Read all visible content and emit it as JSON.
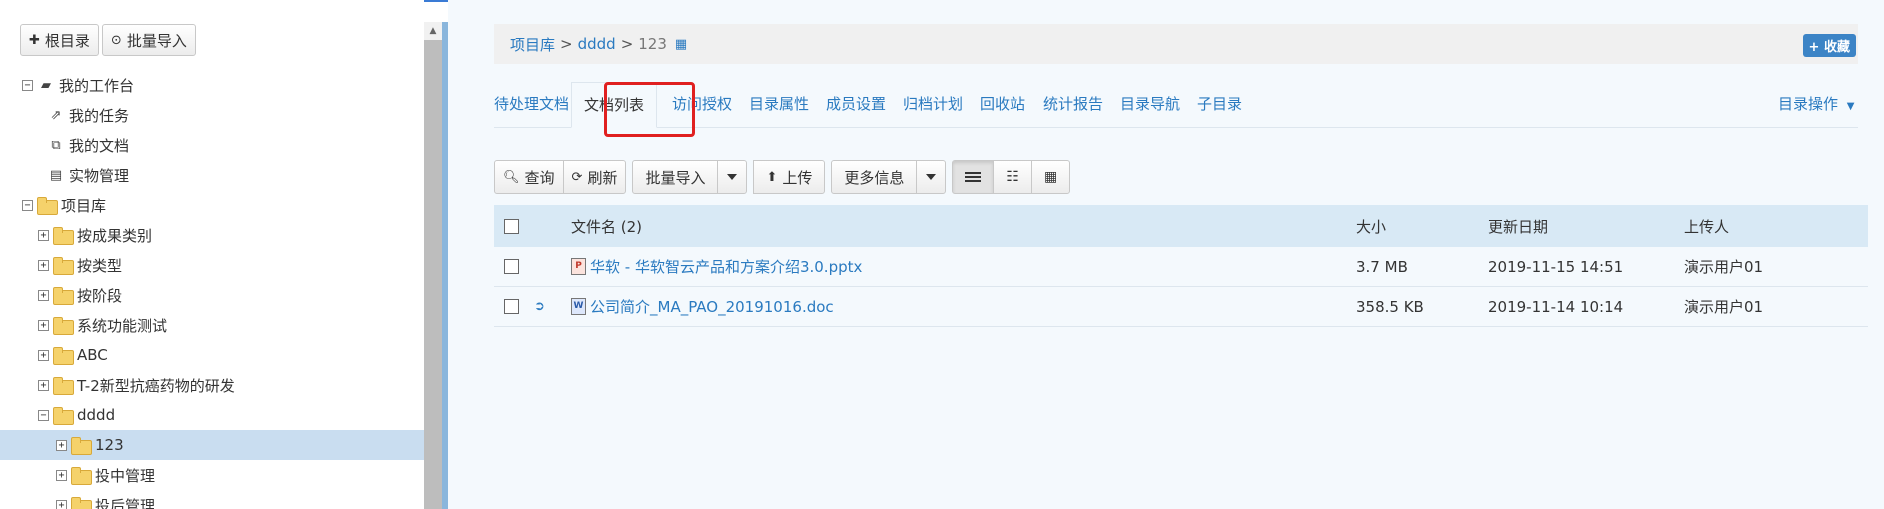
{
  "left_panel": {
    "buttons": {
      "root": "根目录",
      "batch_import": "批量导入"
    },
    "tree": [
      {
        "label": "我的工作台",
        "level": 0,
        "kind": "briefcase",
        "expand": "−"
      },
      {
        "label": "我的任务",
        "level": 1,
        "kind": "external-link"
      },
      {
        "label": "我的文档",
        "level": 1,
        "kind": "copy"
      },
      {
        "label": "实物管理",
        "level": 1,
        "kind": "server"
      },
      {
        "label": "项目库",
        "level": 0,
        "kind": "folder",
        "expand": "−"
      },
      {
        "label": "按成果类别",
        "level": 1,
        "kind": "folder",
        "expand": "+"
      },
      {
        "label": "按类型",
        "level": 1,
        "kind": "folder",
        "expand": "+"
      },
      {
        "label": "按阶段",
        "level": 1,
        "kind": "folder",
        "expand": "+"
      },
      {
        "label": "系统功能测试",
        "level": 1,
        "kind": "folder",
        "expand": "+"
      },
      {
        "label": "ABC",
        "level": 1,
        "kind": "folder",
        "expand": "+"
      },
      {
        "label": "T-2新型抗癌药物的研发",
        "level": 1,
        "kind": "folder",
        "expand": "+"
      },
      {
        "label": "dddd",
        "level": 1,
        "kind": "folder",
        "expand": "−"
      },
      {
        "label": "123",
        "level": 2,
        "kind": "folder",
        "expand": "+",
        "selected": true
      },
      {
        "label": "投中管理",
        "level": 2,
        "kind": "folder",
        "expand": "+"
      },
      {
        "label": "投后管理",
        "level": 2,
        "kind": "folder",
        "expand": "+"
      }
    ]
  },
  "breadcrumb": {
    "root": "项目库",
    "sep": ">",
    "parent": "dddd",
    "current": "123"
  },
  "favorite_label": "收藏",
  "tabs": [
    "待处理文档",
    "文档列表",
    "访问授权",
    "目录属性",
    "成员设置",
    "归档计划",
    "回收站",
    "统计报告",
    "目录导航",
    "子目录"
  ],
  "active_tab": "文档列表",
  "dir_ops_label": "目录操作",
  "toolbar": {
    "query": "查询",
    "refresh": "刷新",
    "batch_import": "批量导入",
    "upload": "上传",
    "more_info": "更多信息"
  },
  "table": {
    "headers": {
      "name": "文件名 (2)",
      "size": "大小",
      "date": "更新日期",
      "uploader": "上传人"
    },
    "rows": [
      {
        "name": "华软 - 华软智云产品和方案介绍3.0.pptx",
        "type": "ppt",
        "size": "3.7 MB",
        "date": "2019-11-15 14:51",
        "uploader": "演示用户01",
        "checked_out": false
      },
      {
        "name": "公司简介_MA_PAO_20191016.doc",
        "type": "doc",
        "size": "358.5 KB",
        "date": "2019-11-14 10:14",
        "uploader": "演示用户01",
        "checked_out": true
      }
    ]
  },
  "colors": {
    "link": "#2a7ac0",
    "header_bg": "#d8e9f5",
    "highlight": "#e02020",
    "selected_row": "#c9ddf0"
  }
}
